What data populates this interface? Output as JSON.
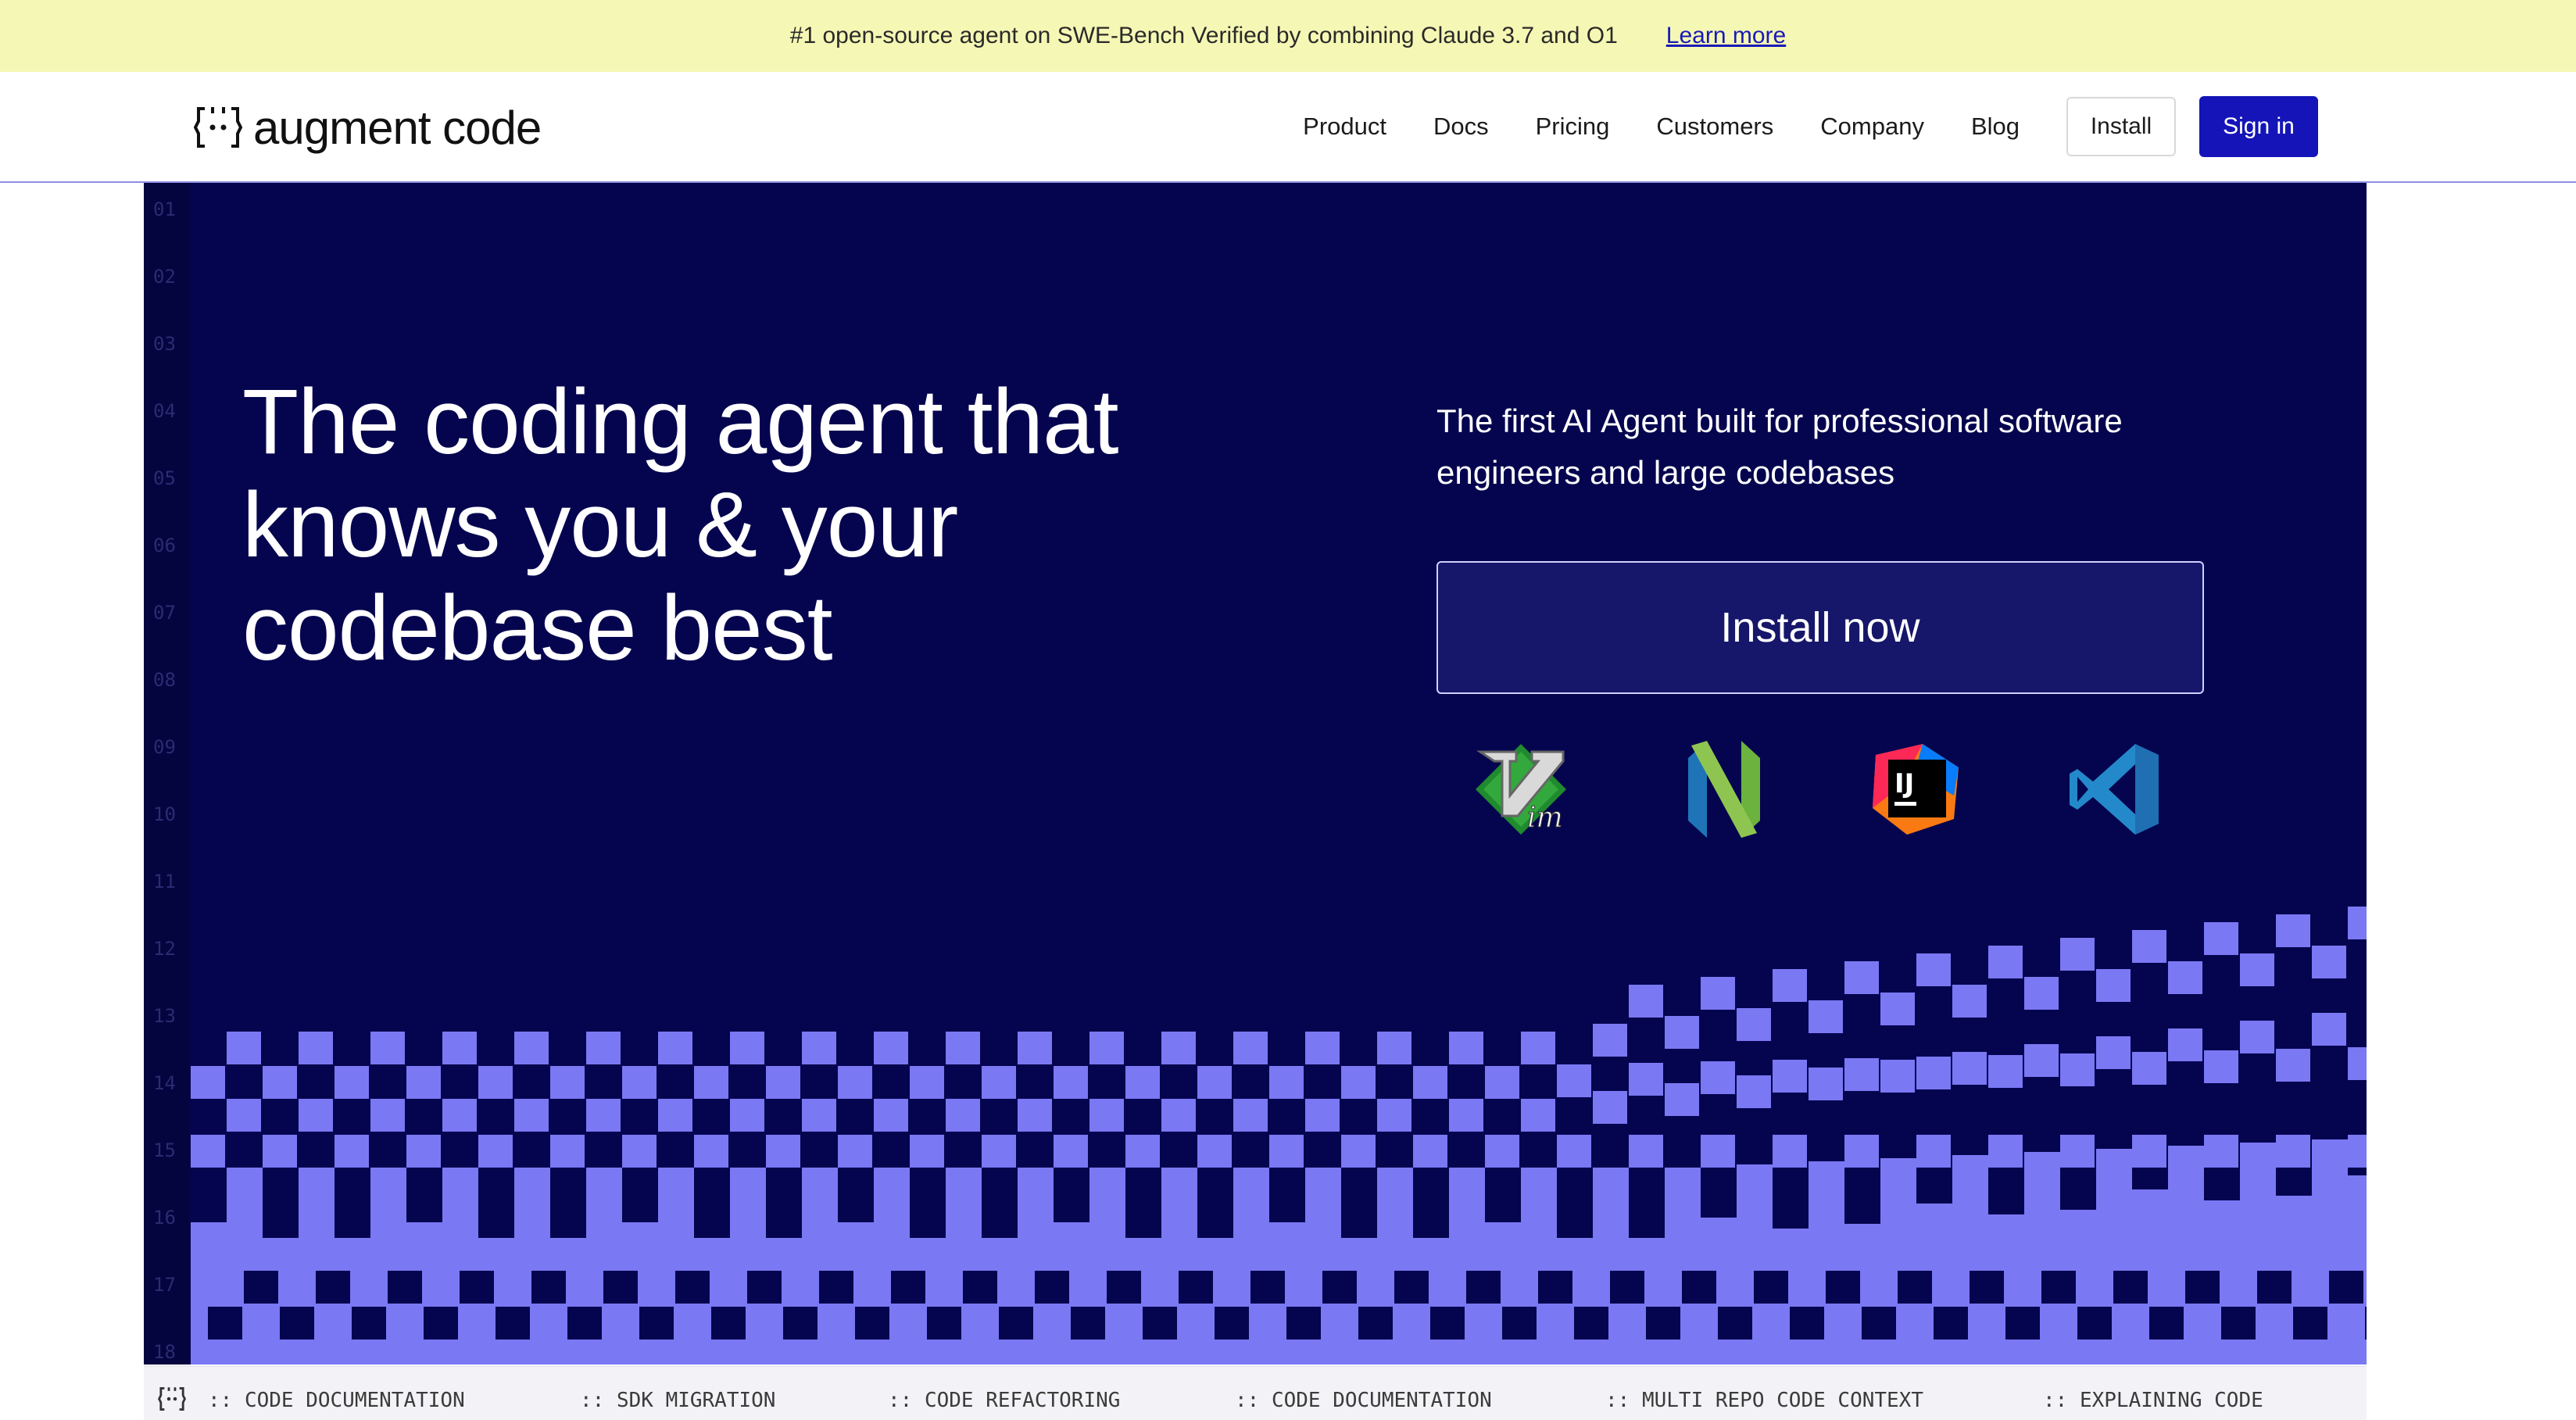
{
  "banner": {
    "text": "#1 open-source agent on SWE-Bench Verified by combining Claude 3.7 and O1",
    "link": "Learn more",
    "bg_color": "#f5f8b4"
  },
  "nav": {
    "logo_text": "augment code",
    "links": [
      "Product",
      "Docs",
      "Pricing",
      "Customers",
      "Company",
      "Blog"
    ],
    "install_label": "Install",
    "signin_label": "Sign in",
    "signin_color": "#1414b8"
  },
  "hero": {
    "title_lines": [
      "The coding agent that",
      "knows you & your",
      "codebase best"
    ],
    "subtitle": "The first AI Agent built for professional software engineers and large codebases",
    "install_now_label": "Install now",
    "line_numbers": [
      "01",
      "02",
      "03",
      "04",
      "05",
      "06",
      "07",
      "08",
      "09",
      "10",
      "11",
      "12",
      "13",
      "14",
      "15",
      "16",
      "17",
      "18"
    ],
    "bg_color": "#05054f",
    "block_color": "#7b78f4",
    "ide_icons": [
      "vim-icon",
      "neovim-icon",
      "intellij-icon",
      "vscode-icon"
    ],
    "ide_labels": [
      "im",
      "IJ"
    ]
  },
  "use_cases": [
    ":: CODE DOCUMENTATION",
    ":: SDK MIGRATION",
    ":: CODE REFACTORING",
    ":: CODE DOCUMENTATION",
    ":: MULTI REPO CODE CONTEXT",
    ":: EXPLAINING CODE"
  ]
}
